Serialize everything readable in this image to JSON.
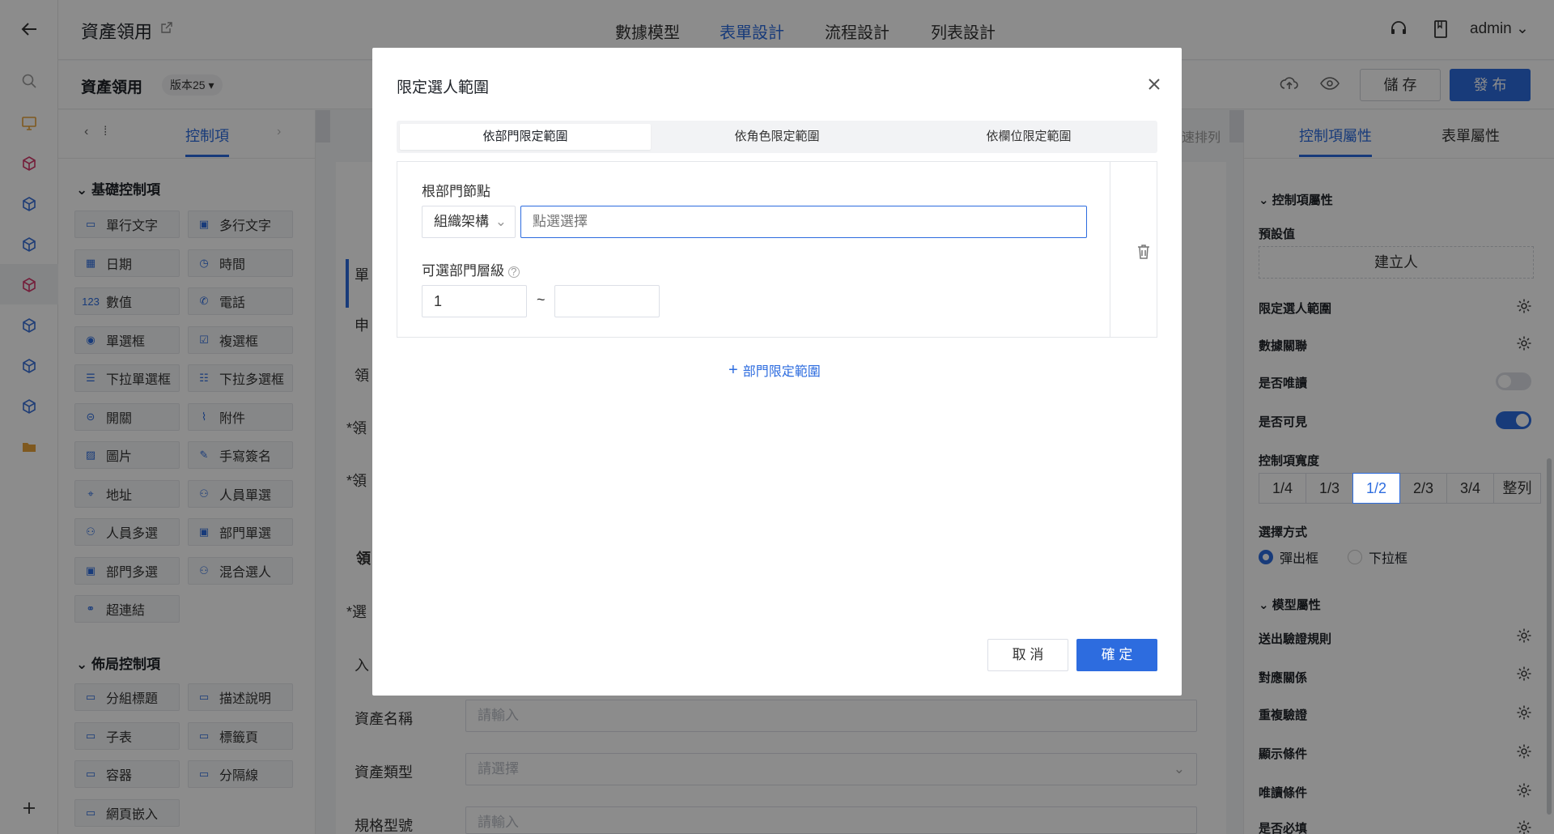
{
  "header": {
    "app_title": "資產領用",
    "tabs": [
      "數據模型",
      "表單設計",
      "流程設計",
      "列表設計"
    ],
    "active_tab": "表單設計",
    "user": "admin"
  },
  "subbar": {
    "form_name": "資產領用",
    "version": "版本25",
    "save_label": "儲 存",
    "publish_label": "發 布"
  },
  "left_panel": {
    "tab_label": "控制項",
    "basic_section": "基礎控制項",
    "basic_items": [
      "單行文字",
      "多行文字",
      "日期",
      "時間",
      "數值",
      "電話",
      "單選框",
      "複選框",
      "下拉單選框",
      "下拉多選框",
      "開關",
      "附件",
      "圖片",
      "手寫簽名",
      "地址",
      "人員單選",
      "人員多選",
      "部門單選",
      "部門多選",
      "混合選人",
      "超連結"
    ],
    "layout_section": "佈局控制項",
    "layout_items": [
      "分組標題",
      "描述說明",
      "子表",
      "標籤頁",
      "容器",
      "分隔線",
      "網頁嵌入"
    ]
  },
  "canvas": {
    "field_labels": [
      "資產名稱",
      "資產類型",
      "規格型號"
    ],
    "field_placeholders": [
      "請輸入",
      "請選擇",
      "請輸入"
    ],
    "partial_labels": [
      "單",
      "申",
      "領",
      "*領",
      "*領",
      "領",
      "*選",
      "入"
    ],
    "sort_hint": "速排列"
  },
  "right_panel": {
    "tabs": [
      "控制項屬性",
      "表單屬性"
    ],
    "ctrl_section": "控制項屬性",
    "default_label": "預設值",
    "default_value": "建立人",
    "rows": [
      "限定選人範圍",
      "數據關聯",
      "是否唯讀",
      "是否可見"
    ],
    "width_label": "控制項寬度",
    "widths": [
      "1/4",
      "1/3",
      "1/2",
      "2/3",
      "3/4",
      "整列"
    ],
    "selected_width": "1/2",
    "select_mode_label": "選擇方式",
    "select_modes": [
      "彈出框",
      "下拉框"
    ],
    "model_section": "模型屬性",
    "model_rows": [
      "送出驗證規則",
      "對應關係",
      "重複驗證",
      "顯示條件",
      "唯讀條件",
      "是否必填"
    ],
    "readonly_on": false,
    "visible_on": true
  },
  "modal": {
    "title": "限定選人範圍",
    "tabs": [
      "依部門限定範圍",
      "依角色限定範圍",
      "依欄位限定範圍"
    ],
    "active_tab": "依部門限定範圍",
    "root_label": "根部門節點",
    "org_select": "組織架構",
    "pick_placeholder": "點選選擇",
    "level_label": "可選部門層級",
    "level_from": "1",
    "level_to": "",
    "tilde": "~",
    "add_label": "部門限定範圍",
    "cancel_label": "取 消",
    "ok_label": "確 定"
  },
  "colors": {
    "accent": "#2d6cdf",
    "rail_accent": "#d4386a",
    "rail_orange": "#e8a23a"
  }
}
